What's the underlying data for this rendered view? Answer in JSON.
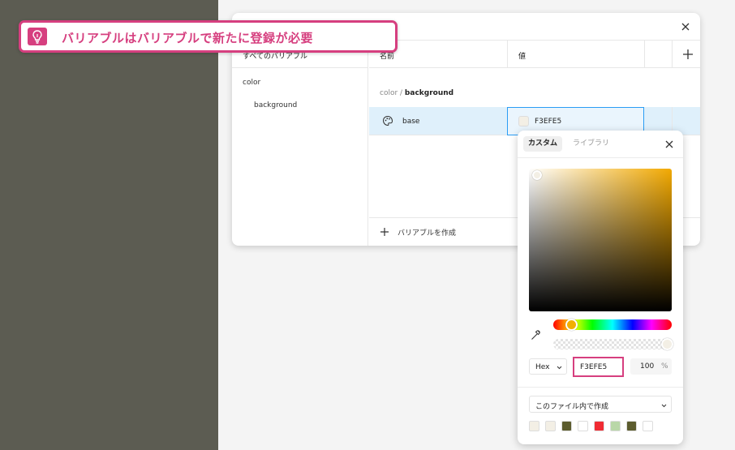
{
  "callout": {
    "text": "バリアブルはバリアブルで新たに登録が必要"
  },
  "sidebar": {
    "header": "すべてのバリアブル",
    "group": "color",
    "item": "background"
  },
  "table": {
    "col_name": "名前",
    "col_value": "値",
    "group_path_prefix": "color / ",
    "group_path_current": "background",
    "rows": [
      {
        "name": "base",
        "value": "F3EFE5",
        "swatch_color": "#F3EFE5"
      }
    ],
    "create_label": "バリアブルを作成"
  },
  "picker": {
    "tabs": [
      "カスタム",
      "ライブラリ"
    ],
    "format": "Hex",
    "hex": "F3EFE5",
    "opacity": "100",
    "opacity_unit": "%",
    "collection": "このファイル内で作成",
    "swatches": [
      "#F3EFE5",
      "#F3EFE5",
      "#5C5C2E",
      "#FFFFFF",
      "#F02B33",
      "#B9D7A8",
      "#5C5C2E",
      "#FFFFFF"
    ]
  },
  "colors": {
    "accent_pink": "#D63F7F",
    "selection_blue": "#2A9DF4",
    "row_highlight": "#DFF0FB"
  }
}
